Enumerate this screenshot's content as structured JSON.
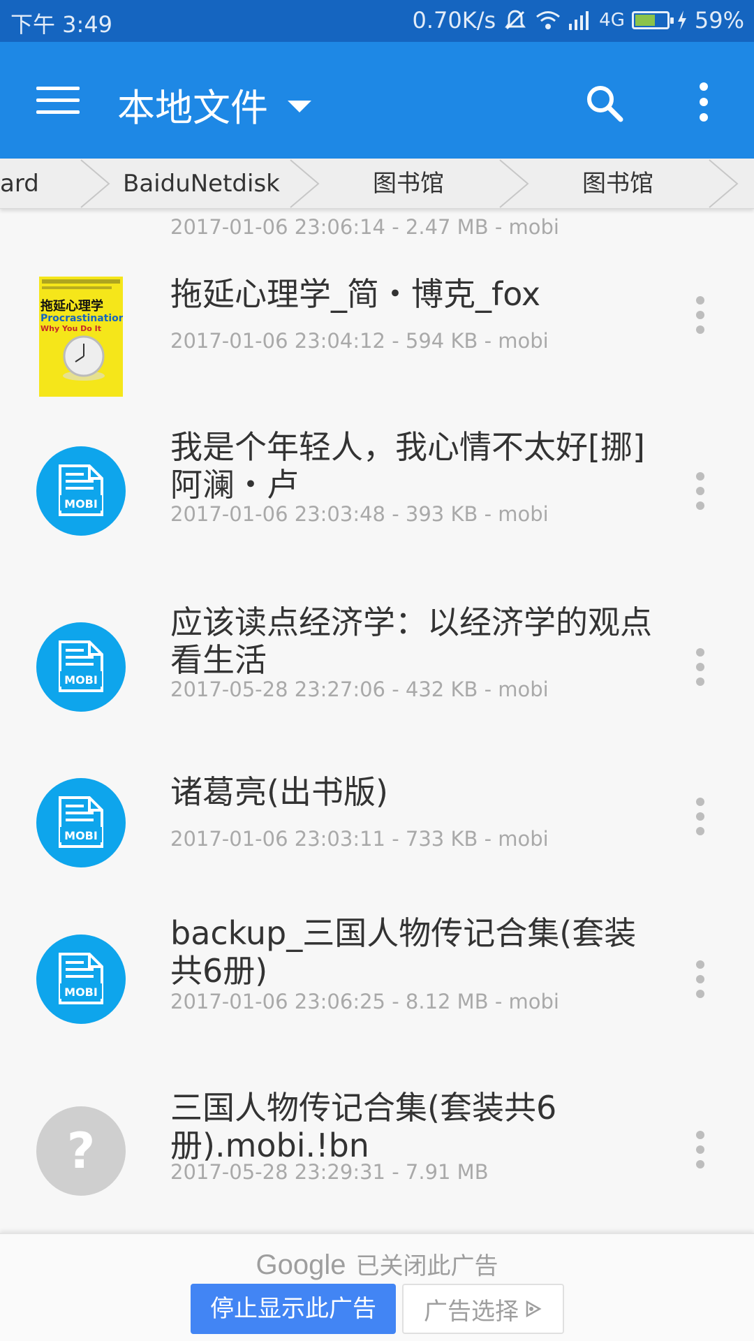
{
  "status_bar": {
    "time": "下午 3:49",
    "net_speed": "0.70K/s",
    "network": "4G",
    "battery_percent": "59%",
    "battery_level": 0.59
  },
  "app_bar": {
    "title": "本地文件",
    "icons": [
      "menu-icon",
      "dropdown-caret-icon",
      "search-icon",
      "more-vert-icon"
    ]
  },
  "breadcrumb": [
    "ard",
    "BaiduNetdisk",
    "图书馆",
    "图书馆"
  ],
  "files": [
    {
      "title": "",
      "meta": "2017-01-06 23:06:14 - 2.47 MB - mobi",
      "icon": "mobi"
    },
    {
      "title": "拖延心理学_简・博克_fox",
      "meta": "2017-01-06 23:04:12 - 594 KB - mobi",
      "icon": "cover",
      "cover_text": {
        "title": "拖延心理学",
        "english1": "Procrastination",
        "english2": "Why You Do It"
      }
    },
    {
      "title": "我是个年轻人，我心情不太好[挪]阿澜・卢",
      "meta": "2017-01-06 23:03:48 - 393 KB - mobi",
      "icon": "mobi"
    },
    {
      "title": "应该读点经济学：以经济学的观点看生活",
      "meta": "2017-05-28 23:27:06 - 432 KB - mobi",
      "icon": "mobi"
    },
    {
      "title": "诸葛亮(出书版)",
      "meta": "2017-01-06 23:03:11 - 733 KB - mobi",
      "icon": "mobi"
    },
    {
      "title": "backup_三国人物传记合集(套装共6册)",
      "meta": "2017-01-06 23:06:25 - 8.12 MB - mobi",
      "icon": "mobi"
    },
    {
      "title": "三国人物传记合集(套装共6册).mobi.!bn",
      "meta": "2017-05-28 23:29:31 - 7.91 MB",
      "icon": "unknown"
    }
  ],
  "mobi_label": "MOBI",
  "unknown_symbol": "?",
  "ad": {
    "brand": "Google",
    "closed_text": "已关闭此广告",
    "stop_button": "停止显示此广告",
    "choice_button": "广告选择"
  },
  "colors": {
    "status_bar": "#1565c0",
    "app_bar": "#1e88e5",
    "mobi_icon": "#0ea5ec",
    "unknown_icon": "#cfcfcf",
    "ad_button": "#4285f4"
  }
}
